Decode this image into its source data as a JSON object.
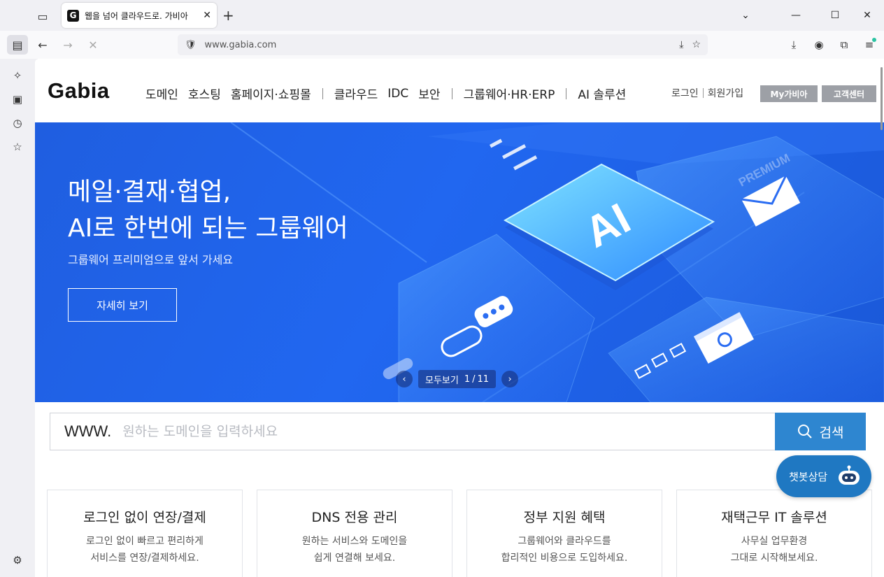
{
  "browser": {
    "tab_title": "웹을 넘어 클라우드로. 가비아",
    "tab_favicon": "G",
    "new_tab": "+",
    "url": "www.gabia.com"
  },
  "site": {
    "logo": "Gabia",
    "nav": {
      "group1": [
        "도메인",
        "호스팅",
        "홈페이지·쇼핑몰"
      ],
      "group2": [
        "클라우드",
        "IDC",
        "보안"
      ],
      "group3": [
        "그룹웨어·HR·ERP"
      ],
      "group4": [
        "AI 솔루션"
      ]
    },
    "util": {
      "login": "로그인",
      "signup": "회원가입",
      "my_gabia": "My가비아",
      "support": "고객센터"
    }
  },
  "hero": {
    "title_line1": "메일·결재·협업,",
    "title_line2": "AI로 한번에 되는 그룹웨어",
    "subtitle": "그룹웨어 프리미엄으로 앞서 가세요",
    "button": "자세히 보기",
    "art_ai": "AI",
    "art_premium": "PREMIUM",
    "pager": {
      "view_all": "모두보기",
      "current": "1",
      "total": "11",
      "separator": "/"
    }
  },
  "search": {
    "prefix": "WWW.",
    "placeholder": "원하는 도메인을 입력하세요",
    "value": "",
    "button": "검색"
  },
  "cards": [
    {
      "title": "로그인 없이 연장/결제",
      "desc1": "로그인 없이 빠르고 편리하게",
      "desc2": "서비스를 연장/결제하세요."
    },
    {
      "title": "DNS 전용 관리",
      "desc1": "원하는 서비스와 도메인을",
      "desc2": "쉽게 연결해 보세요."
    },
    {
      "title": "정부 지원 혜택",
      "desc1": "그룹웨어와 클라우드를",
      "desc2": "합리적인 비용으로 도입하세요."
    },
    {
      "title": "재택근무 IT 솔루션",
      "desc1": "사무실 업무환경",
      "desc2": "그대로 시작해보세요."
    }
  ],
  "chatbot": {
    "label": "챗봇상담"
  },
  "colors": {
    "hero_blue": "#2167f0",
    "search_button": "#2e86d0",
    "chatbot": "#1f78c2",
    "util_button": "#9da0a6"
  }
}
